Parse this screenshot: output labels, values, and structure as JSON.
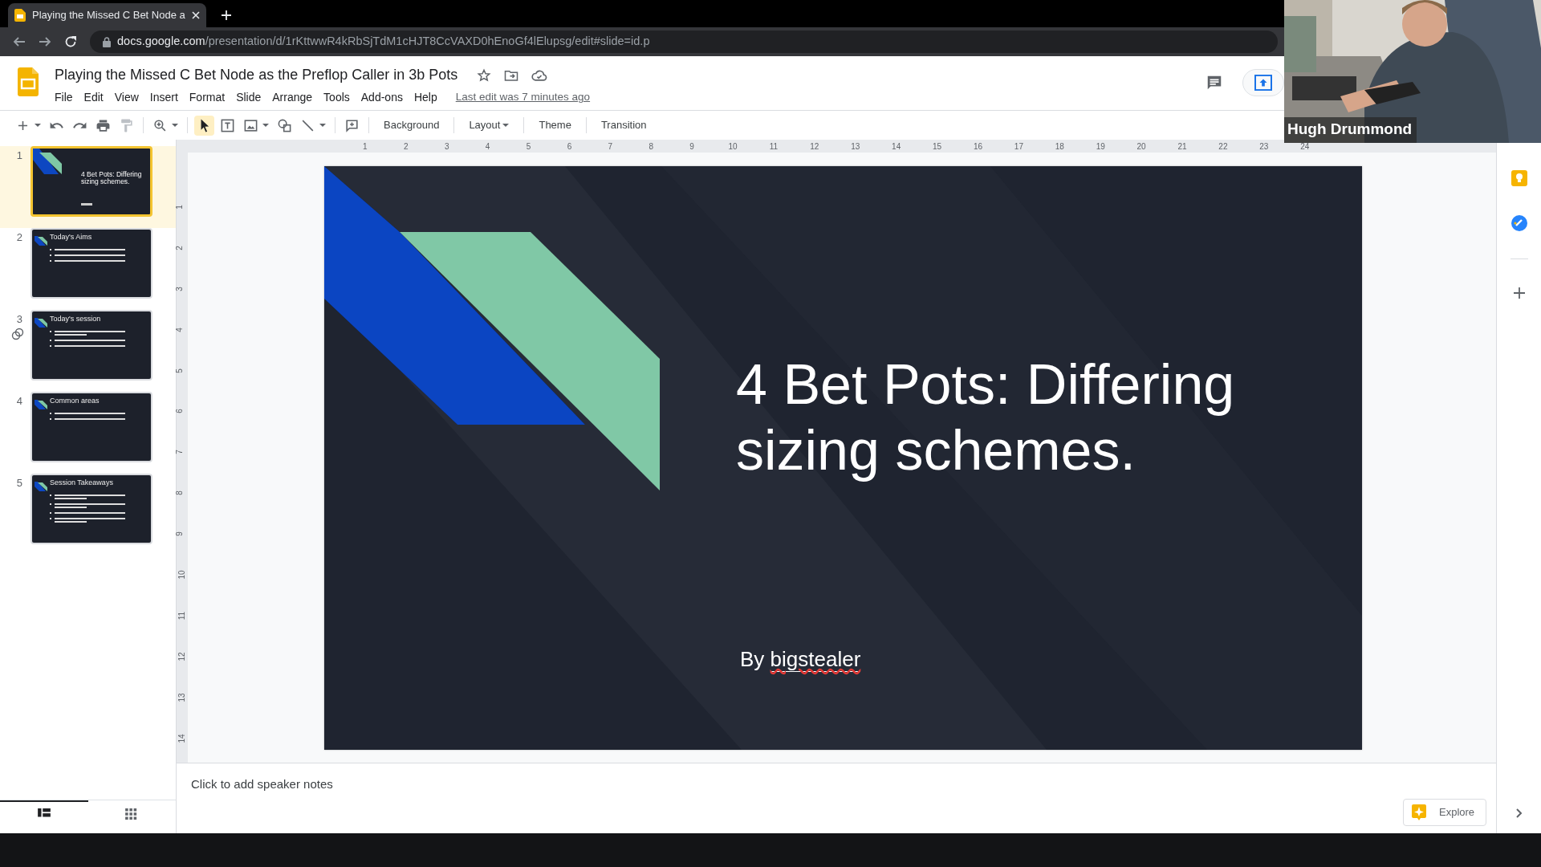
{
  "browser": {
    "tab_title": "Playing the Missed C Bet Node a",
    "url_host": "docs.google.com",
    "url_path": "/presentation/d/1rKttwwR4kRbSjTdM1cHJT8CcVAXD0hEnoGf4lElupsg/edit#slide=id.p"
  },
  "document": {
    "title": "Playing the Missed C Bet Node as the Preflop Caller in 3b Pots",
    "menus": [
      "File",
      "Edit",
      "View",
      "Insert",
      "Format",
      "Slide",
      "Arrange",
      "Tools",
      "Add-ons",
      "Help"
    ],
    "last_edit": "Last edit was 7 minutes ago"
  },
  "toolbar": {
    "tools": [
      {
        "selected": false,
        "dropdown": true
      },
      {
        "selected": false,
        "dropdown": false
      },
      {
        "selected": false,
        "dropdown": false
      },
      {
        "selected": false,
        "dropdown": false
      },
      {
        "selected": false,
        "dropdown": false
      },
      {
        "selected": false,
        "dropdown": true
      },
      {
        "selected": true,
        "dropdown": false
      },
      {
        "selected": false,
        "dropdown": false
      },
      {
        "selected": false,
        "dropdown": true
      },
      {
        "selected": false,
        "dropdown": false
      },
      {
        "selected": false,
        "dropdown": true
      },
      {
        "selected": false,
        "dropdown": false
      }
    ],
    "buttons": [
      {
        "label": "Background",
        "dropdown": false
      },
      {
        "label": "Layout",
        "dropdown": true
      },
      {
        "label": "Theme",
        "dropdown": false
      },
      {
        "label": "Transition",
        "dropdown": false
      }
    ]
  },
  "filmstrip": [
    {
      "number": "1",
      "kind": "title",
      "title": "4 Bet Pots: Differing sizing schemes.",
      "selected": true,
      "badge": false
    },
    {
      "number": "2",
      "kind": "bullets",
      "title": "Today's Aims",
      "selected": false,
      "badge": false,
      "bullets": [
        {
          "wrapped": false
        },
        {
          "wrapped": false
        },
        {
          "wrapped": false
        }
      ]
    },
    {
      "number": "3",
      "kind": "bullets",
      "title": "Today's session",
      "selected": false,
      "badge": true,
      "bullets": [
        {
          "wrapped": true
        },
        {
          "wrapped": false
        },
        {
          "wrapped": false
        }
      ]
    },
    {
      "number": "4",
      "kind": "bullets",
      "title": "Common areas",
      "selected": false,
      "badge": false,
      "bullets": [
        {
          "wrapped": false
        },
        {
          "wrapped": false
        }
      ]
    },
    {
      "number": "5",
      "kind": "bullets",
      "title": "Session Takeaways",
      "selected": false,
      "badge": false,
      "bullets": [
        {
          "wrapped": true
        },
        {
          "wrapped": true
        },
        {
          "wrapped": false
        },
        {
          "wrapped": true
        }
      ]
    }
  ],
  "view_toggle": [
    {
      "selected": true
    },
    {
      "selected": false
    }
  ],
  "ruler": {
    "horizontal": [
      "1",
      "2",
      "3",
      "4",
      "5",
      "6",
      "7",
      "8",
      "9",
      "10",
      "11",
      "12",
      "13",
      "14",
      "15",
      "16",
      "17",
      "18",
      "19",
      "20",
      "21",
      "22",
      "23",
      "24"
    ],
    "vertical": [
      "1",
      "2",
      "3",
      "4",
      "5",
      "6",
      "7",
      "8",
      "9",
      "10",
      "11",
      "12",
      "13",
      "14"
    ]
  },
  "slide": {
    "title": "4 Bet Pots: Differing sizing schemes.",
    "byline": {
      "prefix": "By",
      "name": "bigstealer",
      "misspelled": true
    }
  },
  "notes": {
    "placeholder": "Click to add speaker notes"
  },
  "explore": {
    "label": "Explore"
  },
  "webcam": {
    "kind": "picture",
    "name_label": "Hugh Drummond"
  }
}
